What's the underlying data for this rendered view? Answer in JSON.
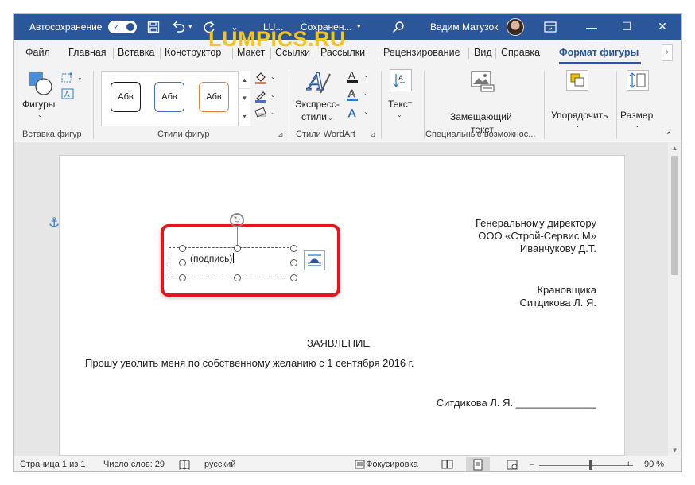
{
  "titlebar": {
    "autosave_label": "Автосохранение",
    "autosave_check": "✓",
    "doc_name": "LU...",
    "doc_status": "Сохранен...",
    "doc_caret": "▾",
    "user_name": "Вадим Матузок",
    "minimize": "—",
    "maximize": "☐",
    "close": "✕"
  },
  "tabs": [
    "Файл",
    "Главная",
    "Вставка",
    "Конструктор",
    "Макет",
    "Ссылки",
    "Рассылки",
    "Рецензирование",
    "Вид",
    "Справка",
    "Формат фигуры"
  ],
  "tab_scroll": "›",
  "ribbon": {
    "shapes_label": "Фигуры",
    "styles": [
      "Абв",
      "Абв",
      "Абв"
    ],
    "express_line1": "Экспресс-",
    "express_line2": "стили",
    "text_label": "Текст",
    "alt_line1": "Замещающий",
    "alt_line2": "текст",
    "arrange_label": "Упорядочить",
    "size_label": "Размер",
    "groups": {
      "insert_shapes": "Вставка фигур",
      "shape_styles": "Стили фигур",
      "wordart_styles": "Стили WordArt",
      "special": "Специальные возможнос..."
    },
    "style_colors": [
      "#1a1a1a",
      "#4472c4",
      "#ed7d31"
    ]
  },
  "document": {
    "watermark": "LUMPICS.RU",
    "addressee": [
      "Генеральному директору",
      "ООО «Строй-Сервис М»",
      "Иванчукову Д.Т."
    ],
    "sender": [
      "Крановщика",
      "Ситдикова Л. Я."
    ],
    "heading": "ЗАЯВЛЕНИЕ",
    "body": "Прошу уволить меня по собственному желанию с 1 сентября 2016 г.",
    "signature_line": "Ситдикова Л. Я. ______________",
    "shape_text": "(подпись)"
  },
  "statusbar": {
    "page": "Страница 1 из 1",
    "words": "Число слов: 29",
    "language": "русский",
    "focus": "Фокусировка",
    "zoom_minus": "–",
    "zoom_plus": "+",
    "zoom": "90 %",
    "zoom_percent": 90
  }
}
